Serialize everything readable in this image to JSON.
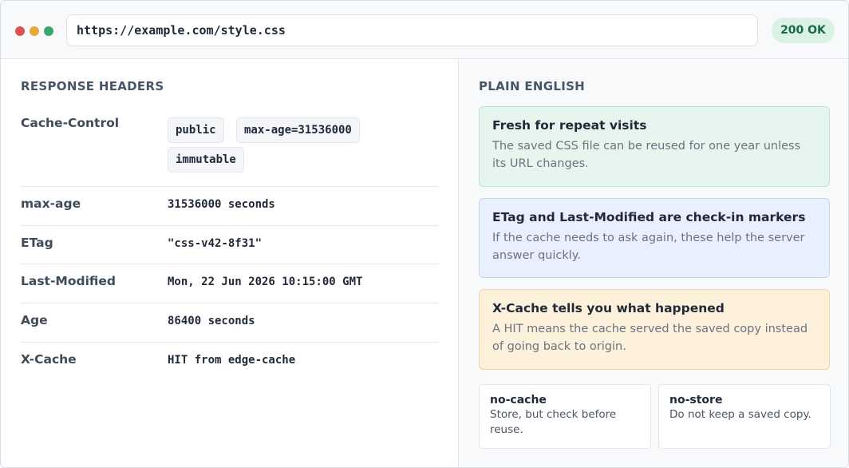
{
  "browser": {
    "url": "https://example.com/style.css",
    "status": "200 OK"
  },
  "headers_panel": {
    "title": "RESPONSE HEADERS",
    "cache_control": {
      "name": "Cache-Control",
      "chips": [
        "public",
        "max-age=31536000",
        "immutable"
      ]
    },
    "rows": [
      {
        "name": "max-age",
        "value": "31536000 seconds"
      },
      {
        "name": "ETag",
        "value": "\"css-v42-8f31\""
      },
      {
        "name": "Last-Modified",
        "value": "Mon, 22 Jun 2026 10:15:00 GMT"
      },
      {
        "name": "Age",
        "value": "86400 seconds"
      },
      {
        "name": "X-Cache",
        "value": "HIT from edge-cache"
      }
    ]
  },
  "explain_panel": {
    "title": "PLAIN ENGLISH",
    "cards": [
      {
        "title": "Fresh for repeat visits",
        "body": "The saved CSS file can be reused for one year unless its URL changes."
      },
      {
        "title": "ETag and Last-Modified are check-in markers",
        "body": "If the cache needs to ask again, these help the server answer quickly."
      },
      {
        "title": "X-Cache tells you what happened",
        "body": "A HIT means the cache served the saved copy instead of going back to origin."
      }
    ],
    "mini_cards": [
      {
        "title": "no-cache",
        "body": "Store, but check before reuse."
      },
      {
        "title": "no-store",
        "body": "Do not keep a saved copy."
      }
    ]
  }
}
